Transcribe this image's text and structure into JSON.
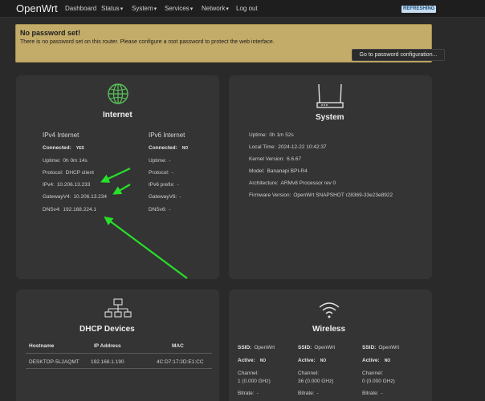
{
  "navbar": {
    "brand": "OpenWrt",
    "items": [
      {
        "label": "Dashboard"
      },
      {
        "label": "Status",
        "caret": "▾"
      },
      {
        "label": "System",
        "caret": "▾"
      },
      {
        "label": "Services",
        "caret": "▾"
      },
      {
        "label": "Network",
        "caret": "▾"
      },
      {
        "label": "Log out"
      }
    ],
    "status_badge": "REFRESHING"
  },
  "alert": {
    "title": "No password set!",
    "text": "There is no password set on this router. Please configure a root password to protect the web interface.",
    "button": "Go to password configuration..."
  },
  "internet": {
    "title": "Internet",
    "ipv4": {
      "heading": "IPv4 Internet",
      "connected_label": "Connected:",
      "connected_value": "YES",
      "uptime_label": "Uptime:",
      "uptime_value": "0h 0m 14s",
      "protocol_label": "Protocol:",
      "protocol_value": "DHCP client",
      "ip_label": "IPv4:",
      "ip_value": "10.206.13.233",
      "gateway_label": "GatewayV4:",
      "gateway_value": "10.206.13.234",
      "dns_label": "DNSv4:",
      "dns_value": "192.168.224.1"
    },
    "ipv6": {
      "heading": "IPv6 Internet",
      "connected_label": "Connected:",
      "connected_value": "NO",
      "uptime_label": "Uptime:",
      "uptime_value": "-",
      "protocol_label": "Protocol:",
      "protocol_value": "-",
      "prefix_label": "IPv6 prefix:",
      "prefix_value": "-",
      "gateway_label": "GatewayV6:",
      "gateway_value": "-",
      "dns_label": "DNSv6:",
      "dns_value": "-"
    },
    "annotation_color": "#27e02a"
  },
  "system": {
    "title": "System",
    "rows": [
      {
        "label": "Uptime:",
        "value": "0h 1m 52s"
      },
      {
        "label": "Local Time:",
        "value": "2024-12-22 10:42:37"
      },
      {
        "label": "Kernel Version:",
        "value": "6.6.67"
      },
      {
        "label": "Model:",
        "value": "Bananapi BPI-R4"
      },
      {
        "label": "Architecture:",
        "value": "ARMv8 Processor rev 0"
      },
      {
        "label": "Firmware Version:",
        "value": "OpenWrt SNAPSHOT r28369-33e23e8922"
      }
    ]
  },
  "dhcp": {
    "title": "DHCP Devices",
    "columns": [
      "Hostname",
      "IP Address",
      "MAC"
    ],
    "rows": [
      [
        "DESKTOP-5L2AQMT",
        "192.168.1.190",
        "4C:D7:17:2D:E1:CC"
      ]
    ]
  },
  "wireless": {
    "title": "Wireless",
    "radios": [
      {
        "ssid_label": "SSID:",
        "ssid": "OpenWrt",
        "active_label": "Active:",
        "active": "NO",
        "channel_label": "Channel:",
        "channel": "1 (0.000 GHz)",
        "bitrate_label": "Bitrate:",
        "bitrate": "-"
      },
      {
        "ssid_label": "SSID:",
        "ssid": "OpenWrt",
        "active_label": "Active:",
        "active": "NO",
        "channel_label": "Channel:",
        "channel": "36 (0.000 GHz)",
        "bitrate_label": "Bitrate:",
        "bitrate": "-"
      },
      {
        "ssid_label": "SSID:",
        "ssid": "OpenWrt",
        "active_label": "Active:",
        "active": "NO",
        "channel_label": "Channel:",
        "channel": "0 (0.000 GHz)",
        "bitrate_label": "Bitrate:",
        "bitrate": "-"
      }
    ]
  },
  "colors": {
    "background": "#2a2a2a",
    "card": "#343434",
    "alert": "#c3ab69",
    "icon_green": "#58c25a"
  }
}
